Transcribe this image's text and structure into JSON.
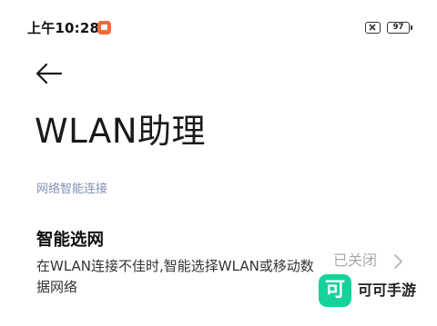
{
  "status_bar": {
    "time": "上午10:28",
    "battery": "97",
    "app_icon": "xiaomi-app-icon",
    "mute_icon": "mute-icon"
  },
  "header": {
    "back_icon": "back-arrow-icon",
    "title": "WLAN助理"
  },
  "section": {
    "header": "网络智能连接",
    "header_color": "#7f92b7"
  },
  "setting": {
    "title": "智能选网",
    "description": "在WLAN连接不佳时,智能选择WLAN或移动数据网络",
    "value": "已关闭",
    "chevron_icon": "chevron-right-icon"
  },
  "watermark": {
    "logo_char": "可",
    "text": "可可手游",
    "color": "#14d39a"
  }
}
